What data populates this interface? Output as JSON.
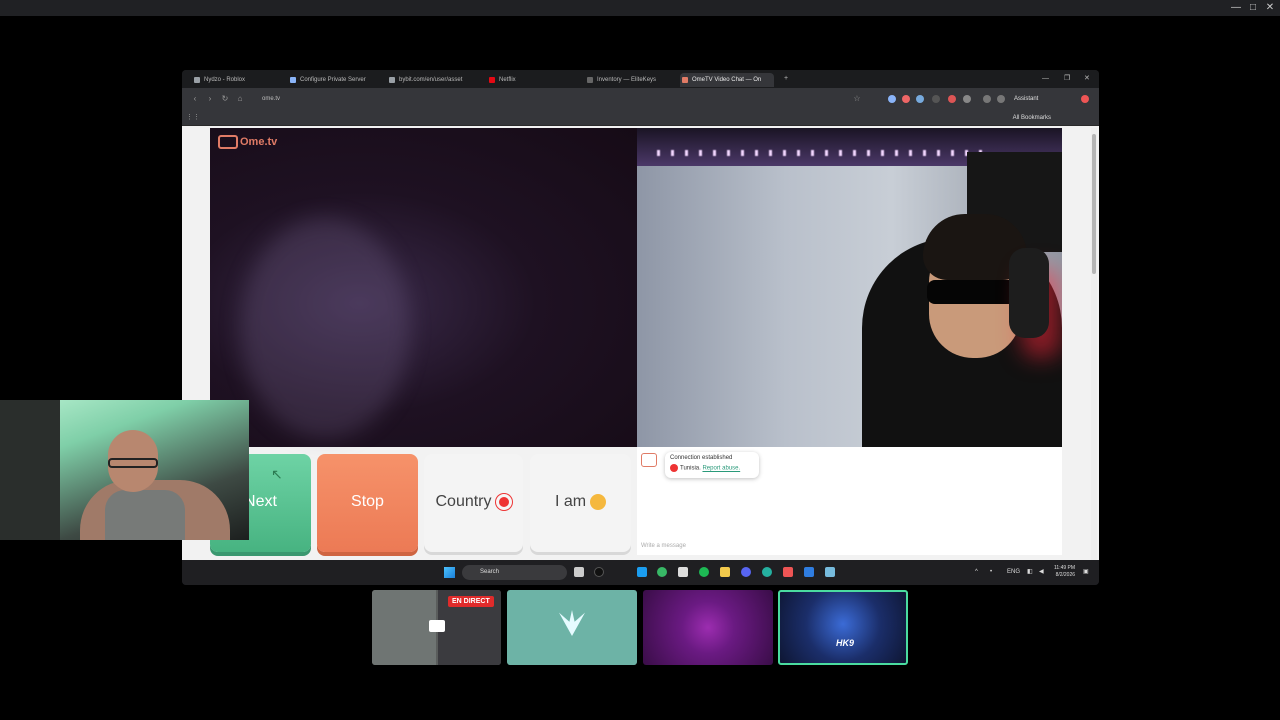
{
  "browser": {
    "tabs": [
      {
        "label": "Nydzo - Roblox",
        "color": "#9aa0a6"
      },
      {
        "label": "Configure Private Server",
        "color": "#8ab4f8"
      },
      {
        "label": "bybit.com/en/user/asset",
        "color": "#9aa0a6"
      },
      {
        "label": "Netflix",
        "color": "#e50914"
      },
      {
        "label": "Inventory — EliteKeys",
        "color": "#444444"
      },
      {
        "label": "OmeTV Video Chat — On",
        "color": "#e07b66"
      }
    ],
    "url": "ome.tv",
    "assistant_label": "Assistant",
    "all_bookmarks": "All Bookmarks"
  },
  "ometv": {
    "logo": "Ome.tv",
    "buttons": {
      "next": "Next",
      "stop": "Stop",
      "country": "Country",
      "iam": "I am"
    },
    "chat": {
      "status": "Connection established",
      "country": "Tunisia.",
      "report_link": "Report abuse.",
      "placeholder": "Write a message"
    }
  },
  "taskbar": {
    "search_label": "Search",
    "lang": "ENG",
    "time": "11:49 PM",
    "date": "8/2/2026"
  },
  "scenes": {
    "live_badge": "EN DIRECT",
    "hk_logo": "HK9"
  },
  "colors": {
    "next_green": "#5cc494",
    "stop_orange": "#ef8159",
    "brand": "#e07b66",
    "live_red": "#e02b2b"
  }
}
